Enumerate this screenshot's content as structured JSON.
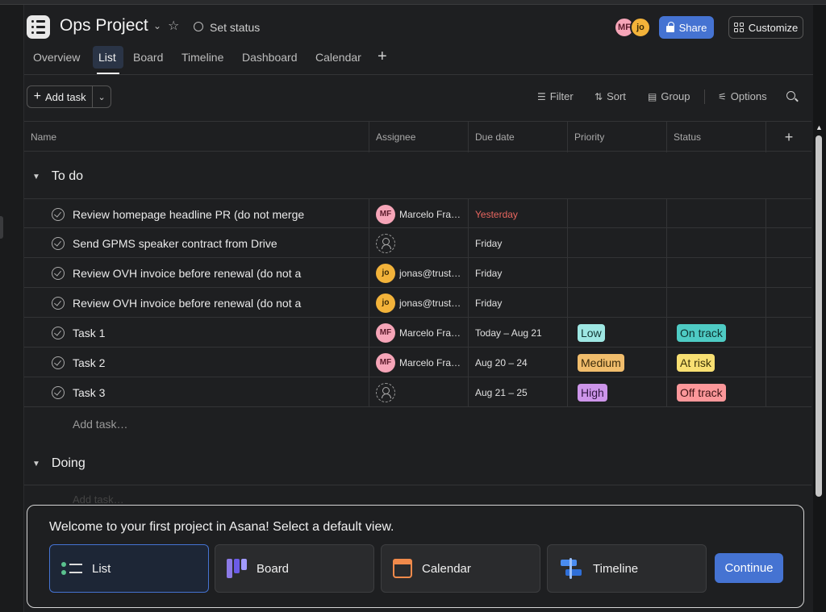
{
  "project": {
    "title": "Ops Project",
    "set_status": "Set status"
  },
  "header": {
    "avatars": [
      "MF",
      "jo"
    ],
    "share_label": "Share",
    "customize_label": "Customize"
  },
  "tabs": [
    {
      "label": "Overview",
      "active": false
    },
    {
      "label": "List",
      "active": true
    },
    {
      "label": "Board",
      "active": false
    },
    {
      "label": "Timeline",
      "active": false
    },
    {
      "label": "Dashboard",
      "active": false
    },
    {
      "label": "Calendar",
      "active": false
    }
  ],
  "toolbar": {
    "add_task_label": "Add task",
    "filter": "Filter",
    "sort": "Sort",
    "group": "Group",
    "options": "Options"
  },
  "columns": [
    "Name",
    "Assignee",
    "Due date",
    "Priority",
    "Status"
  ],
  "sections": [
    {
      "title": "To do",
      "add_task": "Add task…",
      "tasks": [
        {
          "name": "Review homepage headline PR (do not merge",
          "assignee": {
            "initials": "MF",
            "name": "Marcelo Fra…"
          },
          "due": "Yesterday",
          "overdue": true,
          "priority": "",
          "status": ""
        },
        {
          "name": "Send GPMS speaker contract from Drive",
          "assignee": null,
          "due": "Friday",
          "overdue": false,
          "priority": "",
          "status": ""
        },
        {
          "name": "Review OVH invoice before renewal (do not a",
          "assignee": {
            "initials": "jo",
            "name": "jonas@trust…"
          },
          "due": "Friday",
          "overdue": false,
          "priority": "",
          "status": ""
        },
        {
          "name": "Review OVH invoice before renewal (do not a",
          "assignee": {
            "initials": "jo",
            "name": "jonas@trust…"
          },
          "due": "Friday",
          "overdue": false,
          "priority": "",
          "status": ""
        },
        {
          "name": "Task 1",
          "assignee": {
            "initials": "MF",
            "name": "Marcelo Fra…"
          },
          "due": "Today – Aug 21",
          "overdue": false,
          "priority": "Low",
          "status": "On track"
        },
        {
          "name": "Task 2",
          "assignee": {
            "initials": "MF",
            "name": "Marcelo Fra…"
          },
          "due": "Aug 20 – 24",
          "overdue": false,
          "priority": "Medium",
          "status": "At risk"
        },
        {
          "name": "Task 3",
          "assignee": null,
          "due": "Aug 21 – 25",
          "overdue": false,
          "priority": "High",
          "status": "Off track"
        }
      ]
    },
    {
      "title": "Doing",
      "add_task": "Add task…"
    }
  ],
  "pill_colors": {
    "Low": {
      "bg": "#9ee7e3",
      "fg": "#123533"
    },
    "Medium": {
      "bg": "#f1bd6c",
      "fg": "#3b2a0a"
    },
    "High": {
      "bg": "#cd95ea",
      "fg": "#2e1540"
    },
    "On track": {
      "bg": "#4ecbc4",
      "fg": "#0d302e"
    },
    "At risk": {
      "bg": "#f8df72",
      "fg": "#3a3208"
    },
    "Off track": {
      "bg": "#fc979a",
      "fg": "#3d1213"
    }
  },
  "welcome": {
    "message": "Welcome to your first project in Asana! Select a default view.",
    "options": [
      {
        "label": "List",
        "icon": "list-icon",
        "selected": true
      },
      {
        "label": "Board",
        "icon": "board-icon",
        "selected": false
      },
      {
        "label": "Calendar",
        "icon": "calendar-icon",
        "selected": false
      },
      {
        "label": "Timeline",
        "icon": "timeline-icon",
        "selected": false
      }
    ],
    "continue_label": "Continue"
  },
  "colors": {
    "accent": "#4573d2",
    "overdue": "#e8665f",
    "avatar_mf": "#f6a5b8",
    "avatar_jo": "#f3b33a"
  }
}
